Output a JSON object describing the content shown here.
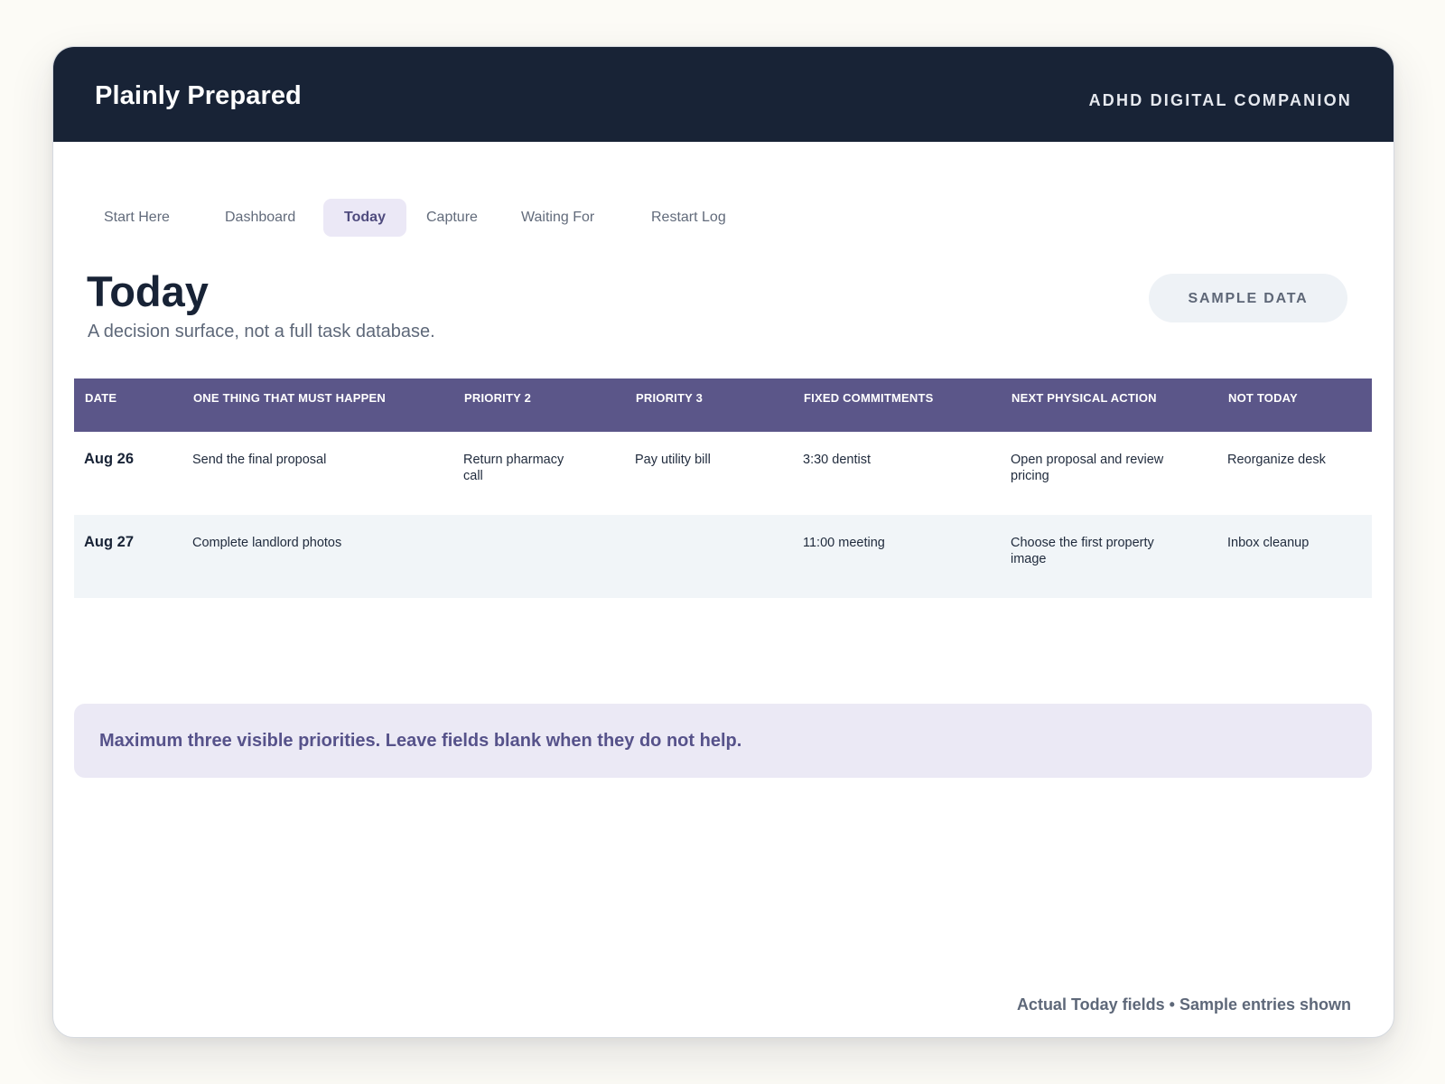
{
  "header": {
    "app_title": "Plainly Prepared",
    "tagline": "ADHD DIGITAL COMPANION"
  },
  "nav": {
    "tabs": [
      {
        "label": "Start Here"
      },
      {
        "label": "Dashboard"
      },
      {
        "label": "Today",
        "active": true
      },
      {
        "label": "Capture"
      },
      {
        "label": "Waiting For"
      },
      {
        "label": "Restart Log"
      }
    ]
  },
  "page": {
    "title": "Today",
    "subtitle": "A decision surface, not a full task database.",
    "badge": "SAMPLE DATA"
  },
  "table": {
    "columns": [
      "DATE",
      "ONE THING THAT MUST HAPPEN",
      "PRIORITY 2",
      "PRIORITY 3",
      "FIXED COMMITMENTS",
      "NEXT PHYSICAL ACTION",
      "NOT TODAY"
    ],
    "rows": [
      {
        "date": "Aug 26",
        "must_happen": "Send the final proposal",
        "priority_2": "Return pharmacy call",
        "priority_3": "Pay utility bill",
        "fixed_commitments": "3:30 dentist",
        "next_action": "Open proposal and review pricing",
        "not_today": "Reorganize desk"
      },
      {
        "date": "Aug 27",
        "must_happen": "Complete landlord photos",
        "priority_2": "",
        "priority_3": "",
        "fixed_commitments": "11:00 meeting",
        "next_action": "Choose the first property image",
        "not_today": "Inbox cleanup"
      }
    ]
  },
  "notice": {
    "text": "Maximum three visible priorities. Leave fields blank when they do not help."
  },
  "footer": {
    "note": "Actual Today fields • Sample entries shown"
  },
  "colors": {
    "header_bg": "#182336",
    "table_header_bg": "#5b5689",
    "active_tab_bg": "#ebe8f6",
    "notice_bg": "#ebe9f5"
  }
}
